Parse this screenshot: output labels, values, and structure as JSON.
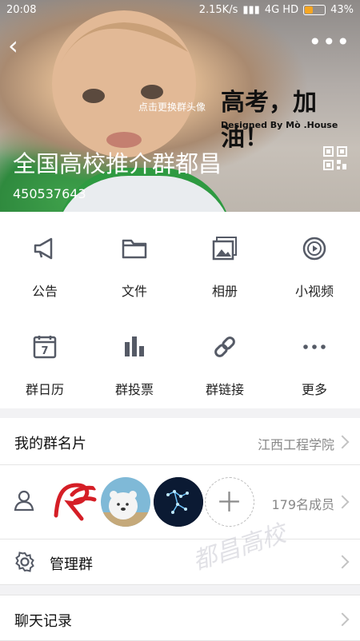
{
  "status_bar": {
    "time": "20:08",
    "speed": "2.15K/s",
    "network": "4G HD",
    "battery": "43%",
    "battery_level": 0.43
  },
  "header": {
    "title": "全国高校推介群都昌",
    "group_id": "450537643",
    "change_avatar_hint": "点击更换群头像",
    "slogan": "高考，加油！",
    "designed_by": "Designed By Mò .House"
  },
  "features": [
    {
      "label": "公告",
      "icon": "megaphone-icon"
    },
    {
      "label": "文件",
      "icon": "folder-icon"
    },
    {
      "label": "相册",
      "icon": "album-icon"
    },
    {
      "label": "小视频",
      "icon": "video-icon"
    },
    {
      "label": "群日历",
      "icon": "calendar-icon",
      "calendar_day": "7"
    },
    {
      "label": "群投票",
      "icon": "vote-icon"
    },
    {
      "label": "群链接",
      "icon": "link-icon"
    },
    {
      "label": "更多",
      "icon": "more-icon"
    }
  ],
  "card": {
    "label": "我的群名片",
    "value": "江西工程学院"
  },
  "members": {
    "count_label": "179名成员"
  },
  "manage": {
    "label": "管理群"
  },
  "chat_history": {
    "label": "聊天记录"
  },
  "watermark": "都昌高校",
  "colors": {
    "icon": "#555a66",
    "accent": "#f5a623",
    "header_green": "#2e9a41"
  }
}
